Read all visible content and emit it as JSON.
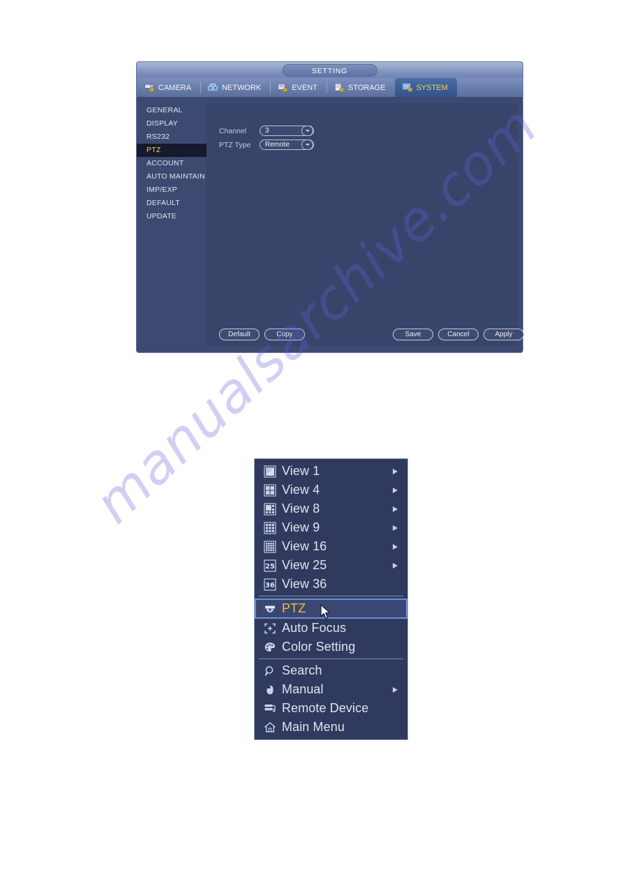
{
  "watermark": {
    "text": "manualsarchive.com"
  },
  "setting_window": {
    "title": "SETTING",
    "tabs": [
      {
        "label": "CAMERA",
        "icon": "camera-gear-icon",
        "active": false
      },
      {
        "label": "NETWORK",
        "icon": "network-icon",
        "active": false
      },
      {
        "label": "EVENT",
        "icon": "event-gear-icon",
        "active": false
      },
      {
        "label": "STORAGE",
        "icon": "storage-gear-icon",
        "active": false
      },
      {
        "label": "SYSTEM",
        "icon": "system-gear-icon",
        "active": true
      }
    ],
    "sidebar": {
      "items": [
        {
          "label": "GENERAL",
          "active": false
        },
        {
          "label": "DISPLAY",
          "active": false
        },
        {
          "label": "RS232",
          "active": false
        },
        {
          "label": "PTZ",
          "active": true
        },
        {
          "label": "ACCOUNT",
          "active": false
        },
        {
          "label": "AUTO MAINTAIN",
          "active": false
        },
        {
          "label": "IMP/EXP",
          "active": false
        },
        {
          "label": "DEFAULT",
          "active": false
        },
        {
          "label": "UPDATE",
          "active": false
        }
      ]
    },
    "form": {
      "channel": {
        "label": "Channel",
        "value": "3"
      },
      "ptz_type": {
        "label": "PTZ Type",
        "value": "Remote"
      }
    },
    "buttons": {
      "default": "Default",
      "copy": "Copy",
      "save": "Save",
      "cancel": "Cancel",
      "apply": "Apply"
    }
  },
  "context_menu": {
    "items": [
      {
        "label": "View 1",
        "icon": "view1-grid-icon",
        "arrow": true,
        "selected": false,
        "separator_after": false
      },
      {
        "label": "View 4",
        "icon": "view4-grid-icon",
        "arrow": true,
        "selected": false,
        "separator_after": false
      },
      {
        "label": "View 8",
        "icon": "view8-grid-icon",
        "arrow": true,
        "selected": false,
        "separator_after": false
      },
      {
        "label": "View 9",
        "icon": "view9-grid-icon",
        "arrow": true,
        "selected": false,
        "separator_after": false
      },
      {
        "label": "View 16",
        "icon": "view16-grid-icon",
        "arrow": true,
        "selected": false,
        "separator_after": false
      },
      {
        "label": "View 25",
        "icon": "view25-grid-icon",
        "arrow": true,
        "selected": false,
        "separator_after": false
      },
      {
        "label": "View 36",
        "icon": "view36-grid-icon",
        "arrow": false,
        "selected": false,
        "separator_after": true
      },
      {
        "label": "PTZ",
        "icon": "ptz-dome-icon",
        "arrow": false,
        "selected": true,
        "separator_after": false
      },
      {
        "label": "Auto Focus",
        "icon": "auto-focus-icon",
        "arrow": false,
        "selected": false,
        "separator_after": false
      },
      {
        "label": "Color Setting",
        "icon": "color-palette-icon",
        "arrow": false,
        "selected": false,
        "separator_after": true
      },
      {
        "label": "Search",
        "icon": "magnifier-icon",
        "arrow": false,
        "selected": false,
        "separator_after": false
      },
      {
        "label": "Manual",
        "icon": "mouse-icon",
        "arrow": true,
        "selected": false,
        "separator_after": false
      },
      {
        "label": "Remote Device",
        "icon": "remote-device-icon",
        "arrow": false,
        "selected": false,
        "separator_after": false
      },
      {
        "label": "Main Menu",
        "icon": "home-icon",
        "arrow": false,
        "selected": false,
        "separator_after": false
      }
    ]
  },
  "cursor": {
    "name": "mouse-pointer"
  }
}
